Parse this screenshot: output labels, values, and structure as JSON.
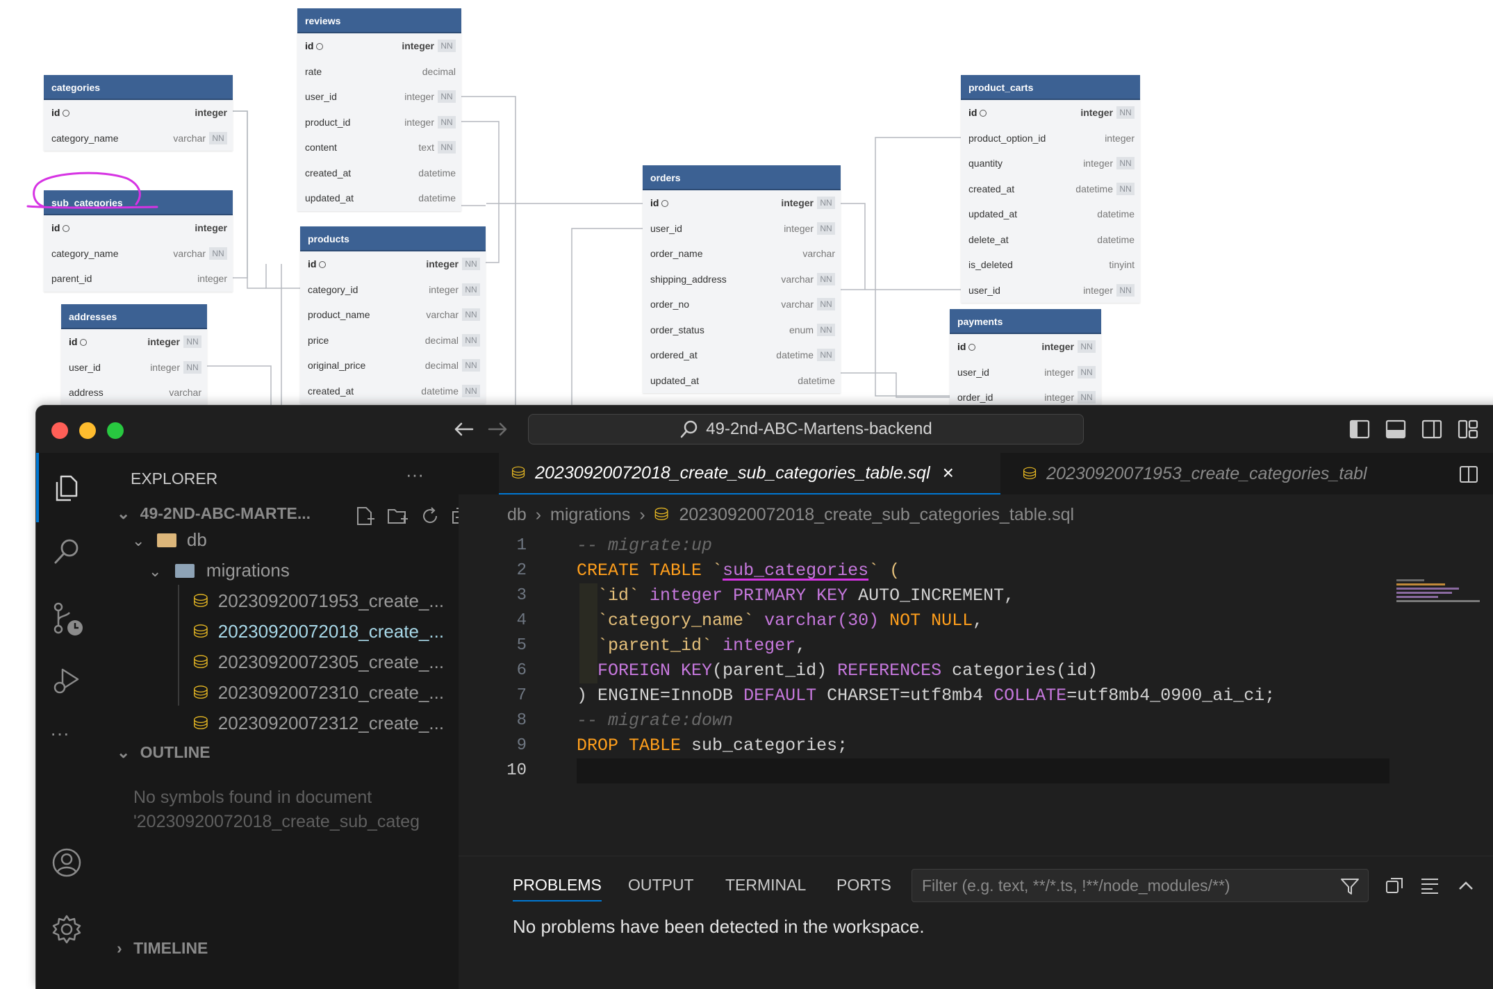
{
  "erd": {
    "tables": {
      "categories": {
        "title": "categories",
        "fields": [
          {
            "name": "id",
            "type": "integer",
            "pk": true,
            "nn": false
          },
          {
            "name": "category_name",
            "type": "varchar",
            "nn": true
          }
        ]
      },
      "sub_categories": {
        "title": "sub_categories",
        "fields": [
          {
            "name": "id",
            "type": "integer",
            "pk": true,
            "nn": false
          },
          {
            "name": "category_name",
            "type": "varchar",
            "nn": true
          },
          {
            "name": "parent_id",
            "type": "integer",
            "nn": false
          }
        ]
      },
      "addresses": {
        "title": "addresses",
        "fields": [
          {
            "name": "id",
            "type": "integer",
            "pk": true,
            "nn": true
          },
          {
            "name": "user_id",
            "type": "integer",
            "nn": true
          },
          {
            "name": "address",
            "type": "varchar",
            "nn": false
          }
        ]
      },
      "reviews": {
        "title": "reviews",
        "fields": [
          {
            "name": "id",
            "type": "integer",
            "pk": true,
            "nn": true
          },
          {
            "name": "rate",
            "type": "decimal",
            "nn": false
          },
          {
            "name": "user_id",
            "type": "integer",
            "nn": true
          },
          {
            "name": "product_id",
            "type": "integer",
            "nn": true
          },
          {
            "name": "content",
            "type": "text",
            "nn": true
          },
          {
            "name": "created_at",
            "type": "datetime",
            "nn": false
          },
          {
            "name": "updated_at",
            "type": "datetime",
            "nn": false
          }
        ]
      },
      "products": {
        "title": "products",
        "fields": [
          {
            "name": "id",
            "type": "integer",
            "pk": true,
            "nn": true
          },
          {
            "name": "category_id",
            "type": "integer",
            "nn": true
          },
          {
            "name": "product_name",
            "type": "varchar",
            "nn": true
          },
          {
            "name": "price",
            "type": "decimal",
            "nn": true
          },
          {
            "name": "original_price",
            "type": "decimal",
            "nn": true
          },
          {
            "name": "created_at",
            "type": "datetime",
            "nn": true
          }
        ]
      },
      "orders": {
        "title": "orders",
        "fields": [
          {
            "name": "id",
            "type": "integer",
            "pk": true,
            "nn": true
          },
          {
            "name": "user_id",
            "type": "integer",
            "nn": true
          },
          {
            "name": "order_name",
            "type": "varchar",
            "nn": false
          },
          {
            "name": "shipping_address",
            "type": "varchar",
            "nn": true
          },
          {
            "name": "order_no",
            "type": "varchar",
            "nn": true
          },
          {
            "name": "order_status",
            "type": "enum",
            "nn": true
          },
          {
            "name": "ordered_at",
            "type": "datetime",
            "nn": true
          },
          {
            "name": "updated_at",
            "type": "datetime",
            "nn": false
          }
        ]
      },
      "product_carts": {
        "title": "product_carts",
        "fields": [
          {
            "name": "id",
            "type": "integer",
            "pk": true,
            "nn": true
          },
          {
            "name": "product_option_id",
            "type": "integer",
            "nn": false
          },
          {
            "name": "quantity",
            "type": "integer",
            "nn": true
          },
          {
            "name": "created_at",
            "type": "datetime",
            "nn": true
          },
          {
            "name": "updated_at",
            "type": "datetime",
            "nn": false
          },
          {
            "name": "delete_at",
            "type": "datetime",
            "nn": false
          },
          {
            "name": "is_deleted",
            "type": "tinyint",
            "nn": false
          },
          {
            "name": "user_id",
            "type": "integer",
            "nn": true
          }
        ]
      },
      "payments": {
        "title": "payments",
        "fields": [
          {
            "name": "id",
            "type": "integer",
            "pk": true,
            "nn": true
          },
          {
            "name": "user_id",
            "type": "integer",
            "nn": true
          },
          {
            "name": "order_id",
            "type": "integer",
            "nn": true
          }
        ]
      }
    },
    "nn_label": "NN"
  },
  "window": {
    "search_text": "49-2nd-ABC-Martens-backend",
    "traffic_colors": [
      "#ff5f57",
      "#febc2e",
      "#28c840"
    ]
  },
  "sidebar": {
    "title": "EXPLORER",
    "more": "···",
    "workspace": "49-2ND-ABC-MARTE...",
    "folder_db": "db",
    "folder_migrations": "migrations",
    "files": [
      "20230920071953_create_...",
      "20230920072018_create_...",
      "20230920072305_create_...",
      "20230920072310_create_...",
      "20230920072312_create_..."
    ],
    "outline_title": "OUTLINE",
    "outline_msg1": "No symbols found in document",
    "outline_msg2": "'20230920072018_create_sub_categ",
    "timeline_title": "TIMELINE"
  },
  "editor": {
    "active_tab": "20230920072018_create_sub_categories_table.sql",
    "second_tab": "20230920071953_create_categories_tabl",
    "breadcrumb": [
      "db",
      "migrations",
      "20230920072018_create_sub_categories_table.sql"
    ],
    "line_numbers": [
      "1",
      "2",
      "3",
      "4",
      "5",
      "6",
      "7",
      "8",
      "9",
      "10"
    ]
  },
  "code": {
    "l1": "-- migrate:up",
    "l2_kw": "CREATE TABLE",
    "l2_tick": "`",
    "l2_name": "sub_categories",
    "l2_end": "` (",
    "l3_col": "`id`",
    "l3_type": "integer",
    "l3_kw": "PRIMARY KEY",
    "l3_rest": "AUTO_INCREMENT,",
    "l4_col": "`category_name`",
    "l4_type": "varchar(30)",
    "l4_kw": "NOT NULL",
    "l4_rest": ",",
    "l5_col": "`parent_id`",
    "l5_type": "integer",
    "l5_rest": ",",
    "l6_kw": "FOREIGN KEY",
    "l6_a": "(parent_id)",
    "l6_ref": "REFERENCES",
    "l6_b": "categories(id)",
    "l7_a": ") ENGINE=InnoDB",
    "l7_kw1": "DEFAULT",
    "l7_b": "CHARSET=utf8mb4",
    "l7_kw2": "COLLATE",
    "l7_c": "=utf8mb4_0900_ai_ci;",
    "l8": "-- migrate:down",
    "l9_kw": "DROP TABLE",
    "l9_rest": "sub_categories;"
  },
  "panel": {
    "tabs": [
      "PROBLEMS",
      "OUTPUT",
      "TERMINAL",
      "PORTS"
    ],
    "filter_placeholder": "Filter (e.g. text, **/*.ts, !**/node_modules/**)",
    "message": "No problems have been detected in the workspace."
  }
}
